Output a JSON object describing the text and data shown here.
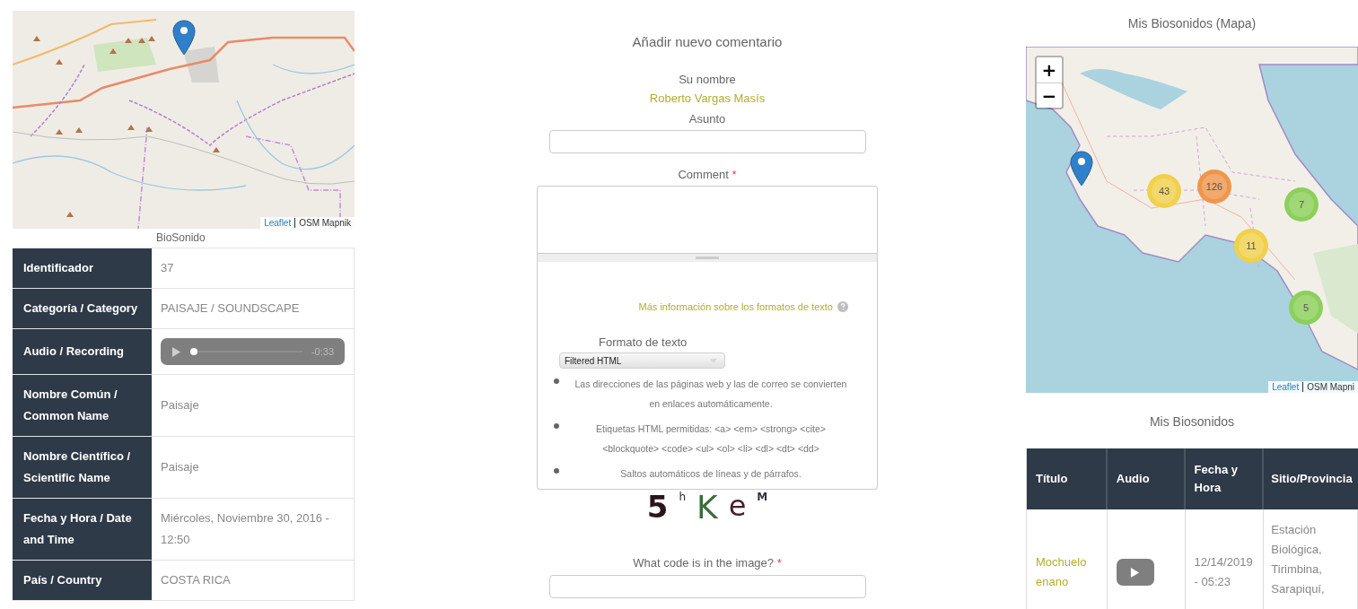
{
  "left_panel": {
    "map": {
      "attribution_link": "Leaflet",
      "attribution": "OSM Mapnik"
    },
    "caption": "BioSonido",
    "details": [
      {
        "kind": "text",
        "label": "Identificador",
        "value": "37"
      },
      {
        "kind": "text",
        "label": "Categoría / Category",
        "value": "PAISAJE / SOUNDSCAPE"
      },
      {
        "kind": "audio",
        "label": "Audio / Recording",
        "level": 0.03,
        "reading": "-0:33"
      },
      {
        "kind": "text",
        "label": "Nombre Común / Common Name",
        "value": "Paisaje"
      },
      {
        "kind": "text",
        "label": "Nombre Científico / Scientific Name",
        "value": "Paisaje"
      },
      {
        "kind": "text",
        "label": "Fecha y Hora / Date and Time",
        "value": "Miércoles, Noviembre 30, 2016 - 12:50"
      },
      {
        "kind": "text",
        "label": "País / Country",
        "value": "COSTA RICA"
      }
    ]
  },
  "comment_form": {
    "title": "Añadir nuevo comentario",
    "name_label": "Su nombre",
    "name_value": "Roberto Vargas Masís",
    "subject_label": "Asunto",
    "comment_label": "Comment",
    "comment_required": "*",
    "format_help_link": "Más información sobre los formatos de texto",
    "format_label": "Formato de texto",
    "format_select": "Filtered HTML",
    "format_tips": [
      "Las direcciones de las páginas web y las de correo se convierten en enlaces automáticamente.",
      "Etiquetas HTML permitidas: <a> <em> <strong> <cite> <blockquote> <code> <ul> <ol> <li> <dl> <dt> <dd>",
      "Saltos automáticos de líneas y de párrafos."
    ],
    "captcha": [
      {
        "char": "5",
        "color": "#2a1518"
      },
      {
        "char": "h",
        "color": "#2b2b2b"
      },
      {
        "char": "K",
        "color": "#3b6e3a"
      },
      {
        "char": "e",
        "color": "#4a1e30"
      },
      {
        "char": "M",
        "color": "#333344"
      }
    ],
    "captcha_label": "What code is in the image?",
    "captcha_required": "*"
  },
  "right_panel": {
    "map_title": "Mis Biosonidos (Mapa)",
    "map": {
      "zoom_in": "+",
      "zoom_out": "−",
      "attribution_link": "Leaflet",
      "attribution": "OSM Mapni",
      "clusters": [
        {
          "count": "43",
          "color": "#f1d04b"
        },
        {
          "count": "126",
          "color": "#f0964b"
        },
        {
          "count": "7",
          "color": "#8ccf5a"
        },
        {
          "count": "11",
          "color": "#f1d04b"
        },
        {
          "count": "5",
          "color": "#8ccf5a"
        }
      ]
    },
    "table_title": "Mis Biosonidos",
    "table": {
      "columns": [
        "Título",
        "Audio",
        "Fecha y Hora",
        "Sitio/Provincia"
      ],
      "rows": [
        {
          "title": "Mochuelo enano",
          "date": "12/14/2019 - 05:23",
          "site": "Estación Biológica, Tirimbina, Sarapiquí,"
        }
      ]
    }
  }
}
